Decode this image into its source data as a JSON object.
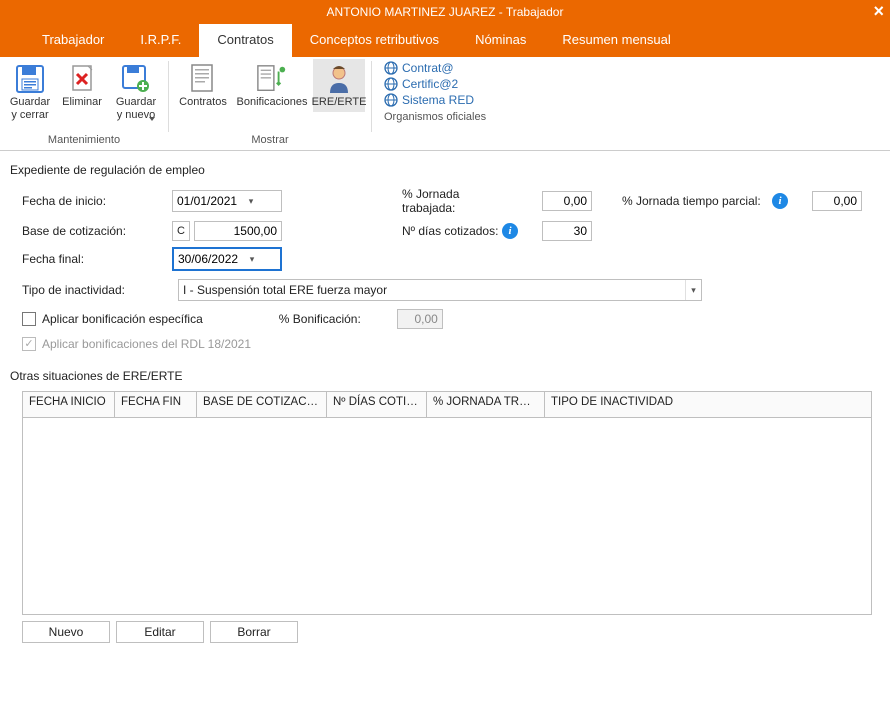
{
  "window": {
    "title": "ANTONIO MARTINEZ JUAREZ - Trabajador"
  },
  "tabs": [
    "Trabajador",
    "I.R.P.F.",
    "Contratos",
    "Conceptos retributivos",
    "Nóminas",
    "Resumen mensual"
  ],
  "active_tab_index": 2,
  "ribbon": {
    "mantenimiento": {
      "label": "Mantenimiento",
      "guardar_cerrar": "Guardar\ny cerrar",
      "eliminar": "Eliminar",
      "guardar_nuevo": "Guardar\ny nuevo"
    },
    "mostrar": {
      "label": "Mostrar",
      "contratos": "Contratos",
      "bonificaciones": "Bonificaciones",
      "ere": "ERE/ERTE"
    },
    "organismos": {
      "label": "Organismos oficiales",
      "items": [
        "Contrat@",
        "Certific@2",
        "Sistema RED"
      ]
    }
  },
  "section_title": "Expediente de regulación de empleo",
  "form": {
    "fecha_inicio_label": "Fecha de inicio:",
    "fecha_inicio": "01/01/2021",
    "jornada_trabajada_label": "% Jornada trabajada:",
    "jornada_trabajada": "0,00",
    "jornada_parcial_label": "% Jornada tiempo parcial:",
    "jornada_parcial": "0,00",
    "base_cotizacion_label": "Base de cotización:",
    "base_cotizacion": "1500,00",
    "dias_cotizados_label": "Nº días cotizados:",
    "dias_cotizados": "30",
    "fecha_final_label": "Fecha final:",
    "fecha_final": "30/06/2022",
    "tipo_inactividad_label": "Tipo de inactividad:",
    "tipo_inactividad": "I - Suspensión total ERE fuerza mayor",
    "bonif_especifica_label": "Aplicar bonificación específica",
    "pct_bonificacion_label": "% Bonificación:",
    "pct_bonificacion": "0,00",
    "bonif_rdl_label": "Aplicar bonificaciones del RDL 18/2021",
    "c_button": "C"
  },
  "subsection_title": "Otras situaciones de ERE/ERTE",
  "grid": {
    "headers": [
      "FECHA INICIO",
      "FECHA FIN",
      "BASE DE COTIZACIÓN",
      "Nº DÍAS COTIZ...",
      "% JORNADA TRAB...",
      "TIPO DE INACTIVIDAD"
    ]
  },
  "grid_buttons": {
    "nuevo": "Nuevo",
    "editar": "Editar",
    "borrar": "Borrar"
  }
}
